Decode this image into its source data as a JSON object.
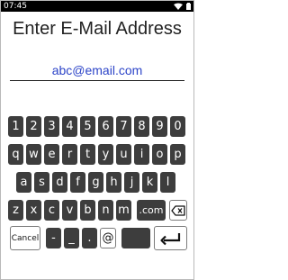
{
  "status": {
    "time": "07:45",
    "icons": [
      "wifi-icon",
      "battery-icon"
    ]
  },
  "title": "Enter E-Mail Address",
  "email": {
    "value": "abc@email.com"
  },
  "keyboard": {
    "row1": [
      "1",
      "2",
      "3",
      "4",
      "5",
      "6",
      "7",
      "8",
      "9",
      "0"
    ],
    "row2": [
      "q",
      "w",
      "e",
      "r",
      "t",
      "y",
      "u",
      "i",
      "o",
      "p"
    ],
    "row3": [
      "a",
      "s",
      "d",
      "f",
      "g",
      "h",
      "j",
      "k",
      "l"
    ],
    "row4": [
      "z",
      "x",
      "c",
      "v",
      "b",
      "n",
      "m"
    ],
    "dotcom": ".com",
    "cancel": "Cancel",
    "dash": "-",
    "underscore": "_",
    "dot": ".",
    "at": "@"
  }
}
